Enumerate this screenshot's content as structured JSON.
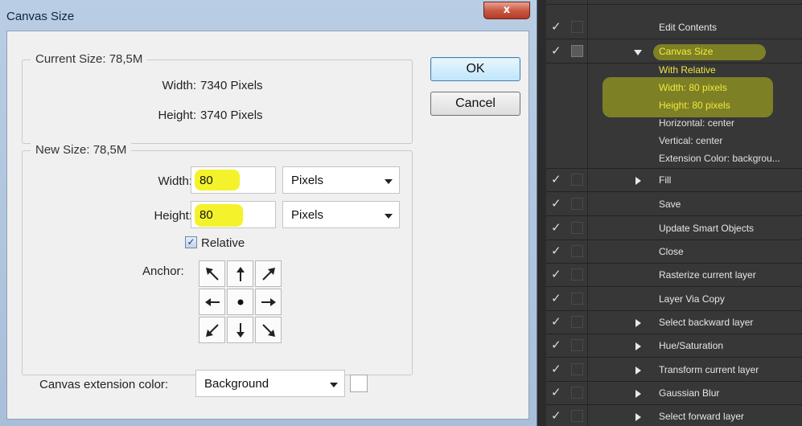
{
  "dialog": {
    "title": "Canvas Size",
    "close_glyph": "x",
    "current_size": {
      "legend": "Current Size: 78,5M",
      "width_label": "Width:",
      "width_value": "7340 Pixels",
      "height_label": "Height:",
      "height_value": "3740 Pixels"
    },
    "new_size": {
      "legend": "New Size: 78,5M",
      "width_label": "Width:",
      "width_value": "80",
      "width_unit": "Pixels",
      "height_label": "Height:",
      "height_value": "80",
      "height_unit": "Pixels",
      "relative_label": "Relative",
      "relative_checked": true,
      "anchor_label": "Anchor:",
      "anchor_cells": [
        "arrow-nw-icon",
        "arrow-n-icon",
        "arrow-ne-icon",
        "arrow-w-icon",
        "anchor-dot-icon",
        "arrow-e-icon",
        "arrow-sw-icon",
        "arrow-s-icon",
        "arrow-se-icon"
      ]
    },
    "extension": {
      "label": "Canvas extension color:",
      "value": "Background"
    },
    "buttons": {
      "ok": "OK",
      "cancel": "Cancel"
    },
    "highlight_color": "#f4f22a"
  },
  "actions_panel": {
    "rows": [
      {
        "label": "Edit Contents",
        "check": "✓",
        "expand": "none"
      },
      {
        "label": "Canvas Size",
        "check": "✓",
        "expand": "open",
        "highlighted": true
      },
      {
        "label": "Fill",
        "check": "✓",
        "expand": "closed"
      },
      {
        "label": "Save",
        "check": "✓",
        "expand": "none"
      },
      {
        "label": "Update Smart Objects",
        "check": "✓",
        "expand": "none"
      },
      {
        "label": "Close",
        "check": "✓",
        "expand": "none"
      },
      {
        "label": "Rasterize current layer",
        "check": "✓",
        "expand": "none"
      },
      {
        "label": "Layer Via Copy",
        "check": "✓",
        "expand": "none"
      },
      {
        "label": "Select backward layer",
        "check": "✓",
        "expand": "closed"
      },
      {
        "label": "Hue/Saturation",
        "check": "✓",
        "expand": "closed"
      },
      {
        "label": "Transform current layer",
        "check": "✓",
        "expand": "closed"
      },
      {
        "label": "Gaussian Blur",
        "check": "✓",
        "expand": "closed"
      },
      {
        "label": "Select forward layer",
        "check": "✓",
        "expand": "closed"
      }
    ],
    "canvas_size_details": [
      "With Relative",
      "Width: 80 pixels",
      "Height: 80 pixels",
      "Horizontal: center",
      "Vertical: center",
      "Extension Color: backgrou..."
    ],
    "highlight_color": "#b9be19"
  }
}
